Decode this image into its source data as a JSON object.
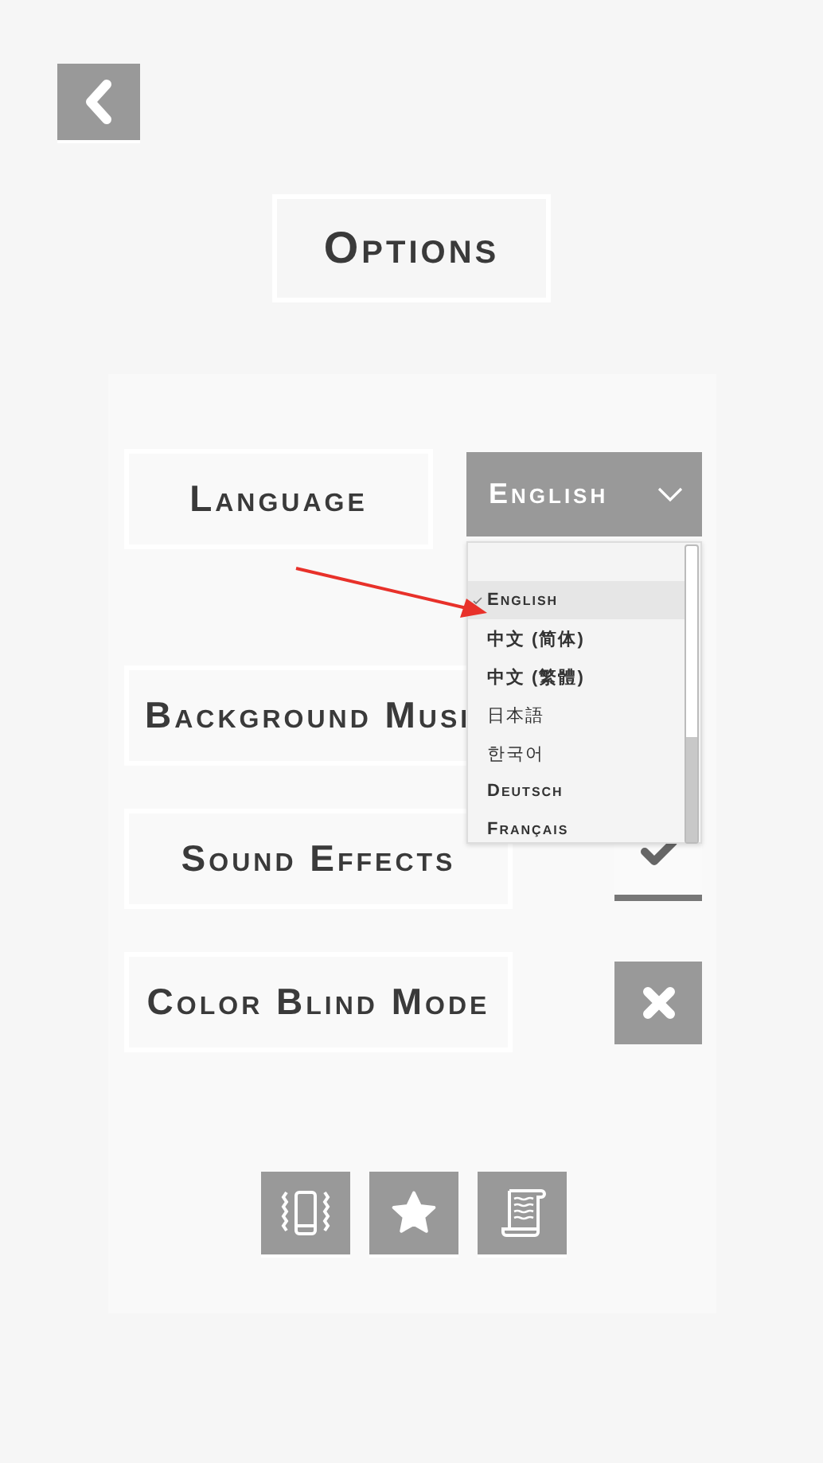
{
  "title": "Options",
  "settings": [
    {
      "kind": "dropdown",
      "label": "Language",
      "value": "English",
      "expanded": true,
      "options": [
        {
          "label": "English",
          "selected": true
        },
        {
          "label": "中文 (简体)",
          "selected": false
        },
        {
          "label": "中文 (繁體)",
          "selected": false
        },
        {
          "label": "日本語",
          "selected": false
        },
        {
          "label": "한국어",
          "selected": false
        },
        {
          "label": "Deutsch",
          "selected": false
        },
        {
          "label": "Français",
          "selected": false
        }
      ]
    },
    {
      "kind": "toggle",
      "label": "Background Musi"
    },
    {
      "kind": "toggle",
      "label": "Sound Effects",
      "checked": true
    },
    {
      "kind": "toggle",
      "label": "Color Blind Mode",
      "checked": false
    }
  ],
  "footer_buttons": [
    {
      "kind": "vibration"
    },
    {
      "kind": "star"
    },
    {
      "kind": "scroll"
    }
  ]
}
